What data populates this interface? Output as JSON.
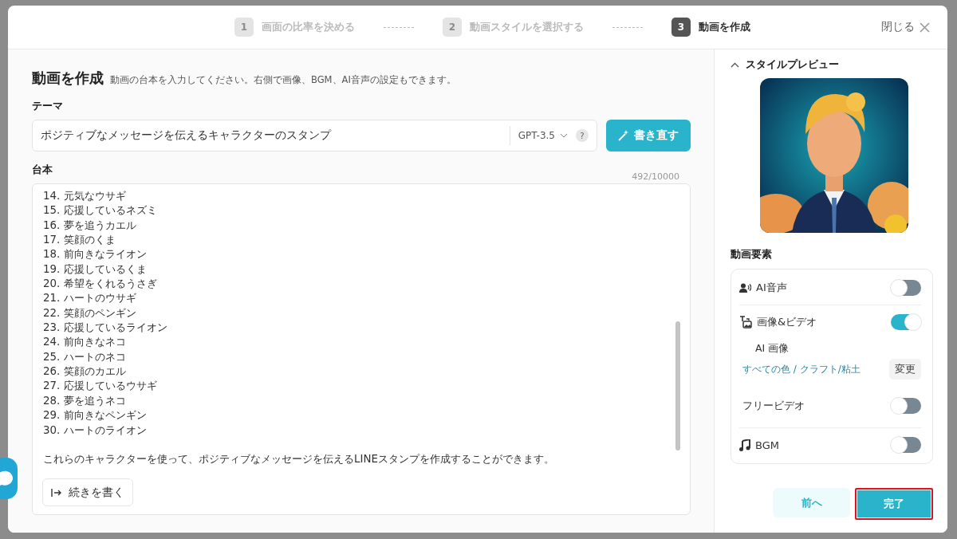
{
  "header": {
    "steps": [
      {
        "number": "1",
        "label": "画面の比率を決める",
        "selected": false
      },
      {
        "number": "2",
        "label": "動画スタイルを選択する",
        "selected": false
      },
      {
        "number": "3",
        "label": "動画を作成",
        "selected": true
      }
    ],
    "close": "閉じる"
  },
  "main": {
    "title": "動画を作成",
    "subtitle": "動画の台本を入力してください。右側で画像、BGM、AI音声の設定もできます。",
    "theme": {
      "label": "テーマ",
      "value": "ポジティブなメッセージを伝えるキャラクターのスタンプ",
      "model": "GPT-3.5",
      "help": "?",
      "rewrite": "書き直す"
    },
    "script": {
      "label": "台本",
      "count": "492/10000",
      "lines": [
        "14. 元気なウサギ",
        "15. 応援しているネズミ",
        "16. 夢を追うカエル",
        "17. 笑顔のくま",
        "18. 前向きなライオン",
        "19. 応援しているくま",
        "20. 希望をくれるうさぎ",
        "21. ハートのウサギ",
        "22. 笑顔のペンギン",
        "23. 応援しているライオン",
        "24. 前向きなネコ",
        "25. ハートのネコ",
        "26. 笑顔のカエル",
        "27. 応援しているウサギ",
        "28. 夢を追うネコ",
        "29. 前向きなペンギン",
        "30. ハートのライオン"
      ],
      "closing": "これらのキャラクターを使って、ポジティブなメッセージを伝えるLINEスタンプを作成することができます。",
      "continue": "続きを書く"
    }
  },
  "side": {
    "preview": {
      "title": "スタイルプレビュー",
      "expanded": true
    },
    "elements": {
      "title": "動画要素",
      "sections": [
        {
          "label": "AI音声",
          "on": false
        },
        {
          "label": "画像&ビデオ",
          "on": true,
          "ai_image": {
            "title": "AI 画像",
            "style": "すべての色 / クラフト/粘土",
            "change": "変更"
          },
          "free_video": {
            "label": "フリービデオ",
            "on": false
          }
        },
        {
          "label": "BGM",
          "on": false
        }
      ]
    }
  },
  "footer": {
    "back": "前へ",
    "done": "完了"
  }
}
